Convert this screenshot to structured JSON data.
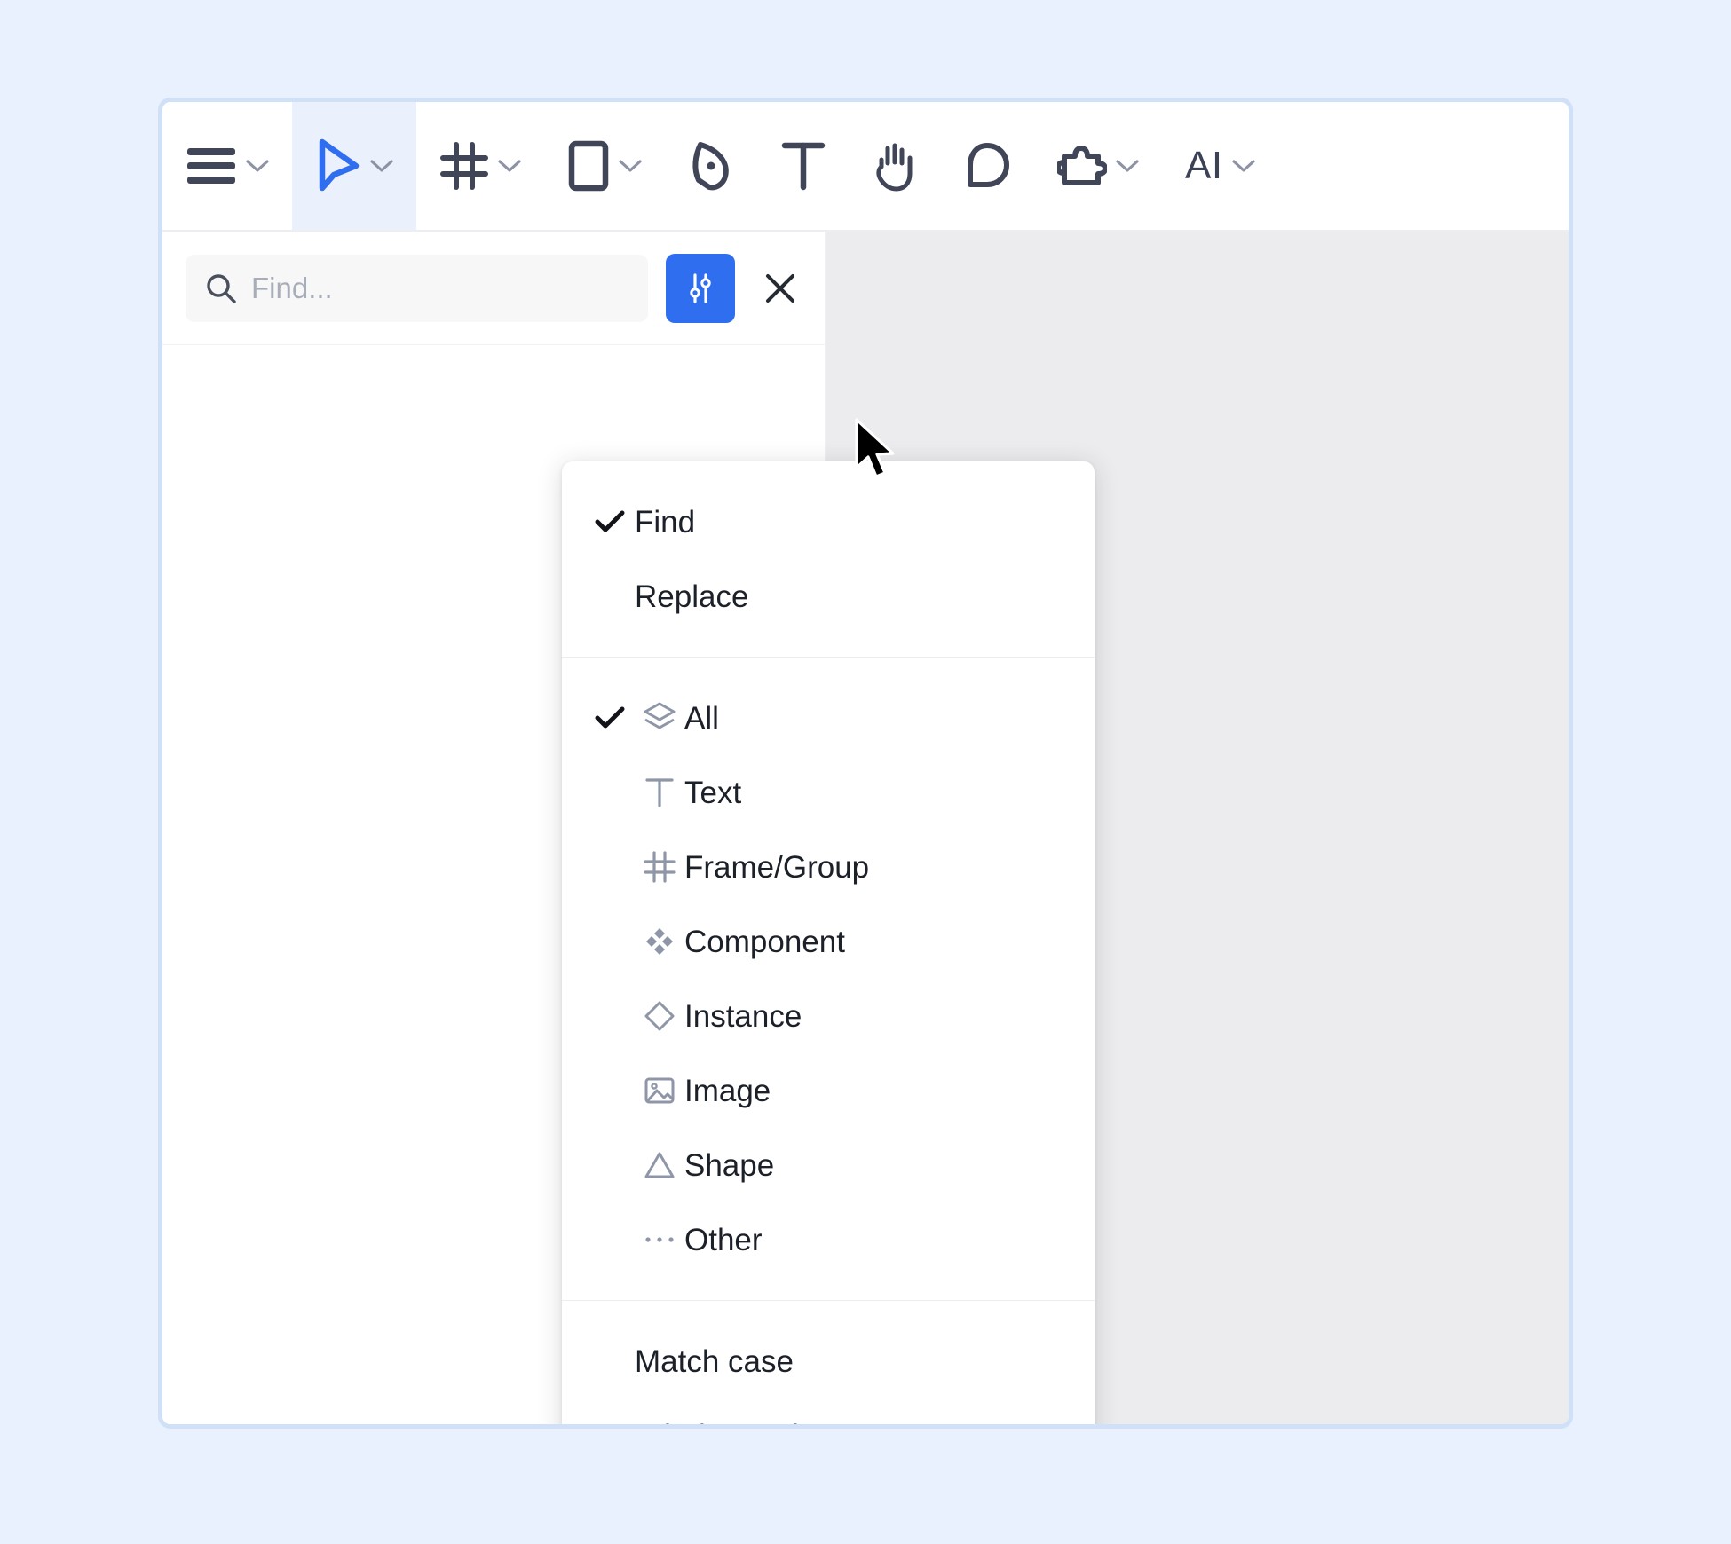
{
  "window": {
    "background_color": "#e8f1fd",
    "border_color": "#cfe0f7",
    "surface_color": "#ffffff",
    "canvas_color": "#ececee",
    "accent_color": "#2f6fef"
  },
  "toolbar": {
    "items": [
      {
        "name": "main-menu",
        "icon": "hamburger-menu-icon",
        "label": "",
        "caret": true,
        "selected": false
      },
      {
        "name": "move-tool",
        "icon": "cursor-arrow-icon",
        "label": "",
        "caret": true,
        "selected": true
      },
      {
        "name": "frame-tool",
        "icon": "frame-hash-icon",
        "label": "",
        "caret": true,
        "selected": false
      },
      {
        "name": "shape-tool",
        "icon": "rectangle-icon",
        "label": "",
        "caret": true,
        "selected": false
      },
      {
        "name": "pen-tool",
        "icon": "pen-nib-icon",
        "label": "",
        "caret": false,
        "selected": false
      },
      {
        "name": "text-tool",
        "icon": "text-t-icon",
        "label": "",
        "caret": false,
        "selected": false
      },
      {
        "name": "hand-tool",
        "icon": "hand-icon",
        "label": "",
        "caret": false,
        "selected": false
      },
      {
        "name": "comment-tool",
        "icon": "comment-bubble-icon",
        "label": "",
        "caret": false,
        "selected": false
      },
      {
        "name": "plugins",
        "icon": "puzzle-piece-icon",
        "label": "",
        "caret": true,
        "selected": false
      },
      {
        "name": "ai-tool",
        "icon": "ai-text-label",
        "label": "AI",
        "caret": true,
        "selected": false
      }
    ]
  },
  "find_bar": {
    "search_icon": "magnifier-icon",
    "placeholder": "Find...",
    "value": "",
    "filter_icon": "sliders-icon",
    "close_icon": "close-x-icon"
  },
  "dropdown": {
    "mode_group": [
      {
        "label": "Find",
        "checked": true,
        "icon": null
      },
      {
        "label": "Replace",
        "checked": false,
        "icon": null
      }
    ],
    "type_group": [
      {
        "label": "All",
        "checked": true,
        "icon": "layers-icon"
      },
      {
        "label": "Text",
        "checked": false,
        "icon": "text-t-icon"
      },
      {
        "label": "Frame/Group",
        "checked": false,
        "icon": "frame-hash-icon"
      },
      {
        "label": "Component",
        "checked": false,
        "icon": "component-diamond-icon"
      },
      {
        "label": "Instance",
        "checked": false,
        "icon": "instance-diamond-icon"
      },
      {
        "label": "Image",
        "checked": false,
        "icon": "image-picture-icon"
      },
      {
        "label": "Shape",
        "checked": false,
        "icon": "shape-triangle-icon"
      },
      {
        "label": "Other",
        "checked": false,
        "icon": "ellipsis-icon"
      }
    ],
    "option_group": [
      {
        "label": "Match case",
        "checked": false,
        "icon": null
      },
      {
        "label": "Whole words",
        "checked": false,
        "icon": null
      }
    ]
  },
  "cursor": {
    "icon": "mouse-pointer-icon"
  }
}
